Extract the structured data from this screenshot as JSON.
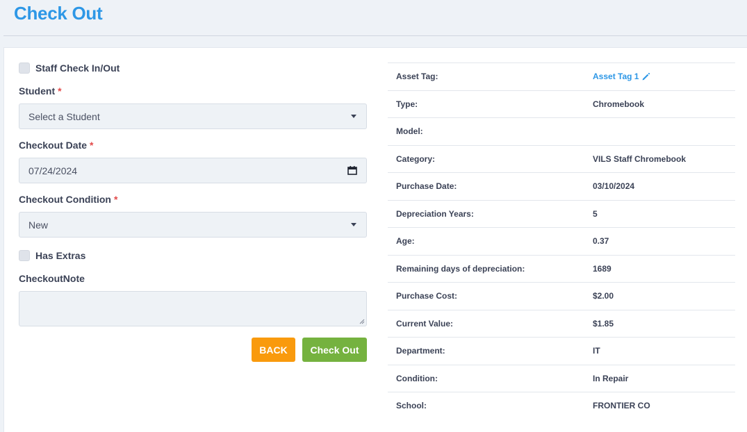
{
  "page": {
    "title": "Check Out"
  },
  "form": {
    "staff_checkbox_label": "Staff Check In/Out",
    "student_label": "Student",
    "student_value": "Select a Student",
    "checkout_date_label": "Checkout Date",
    "checkout_date_value": "07/24/2024",
    "condition_label": "Checkout Condition",
    "condition_value": "New",
    "extras_checkbox_label": "Has Extras",
    "note_label": "CheckoutNote",
    "note_value": "",
    "required_mark": "*",
    "back_label": "BACK",
    "checkout_label": "Check Out"
  },
  "details": {
    "rows": [
      {
        "key": "Asset Tag:",
        "value": "Asset Tag 1"
      },
      {
        "key": "Type:",
        "value": "Chromebook"
      },
      {
        "key": "Model:",
        "value": ""
      },
      {
        "key": "Category:",
        "value": "VILS Staff Chromebook"
      },
      {
        "key": "Purchase Date:",
        "value": "03/10/2024"
      },
      {
        "key": "Depreciation Years:",
        "value": "5"
      },
      {
        "key": "Age:",
        "value": "0.37"
      },
      {
        "key": "Remaining days of depreciation:",
        "value": "1689"
      },
      {
        "key": "Purchase Cost:",
        "value": "$2.00"
      },
      {
        "key": "Current Value:",
        "value": "$1.85"
      },
      {
        "key": "Department:",
        "value": "IT"
      },
      {
        "key": "Condition:",
        "value": "In Repair"
      },
      {
        "key": "School:",
        "value": "FRONTIER CO"
      }
    ]
  },
  "icons": {
    "edit": "pencil-icon",
    "dropdown": "caret-down-icon",
    "calendar": "calendar-icon"
  },
  "colors": {
    "accent": "#2d97e6",
    "back_button": "#f99a0d",
    "checkout_button": "#75b23f",
    "required": "#e24a4a"
  }
}
